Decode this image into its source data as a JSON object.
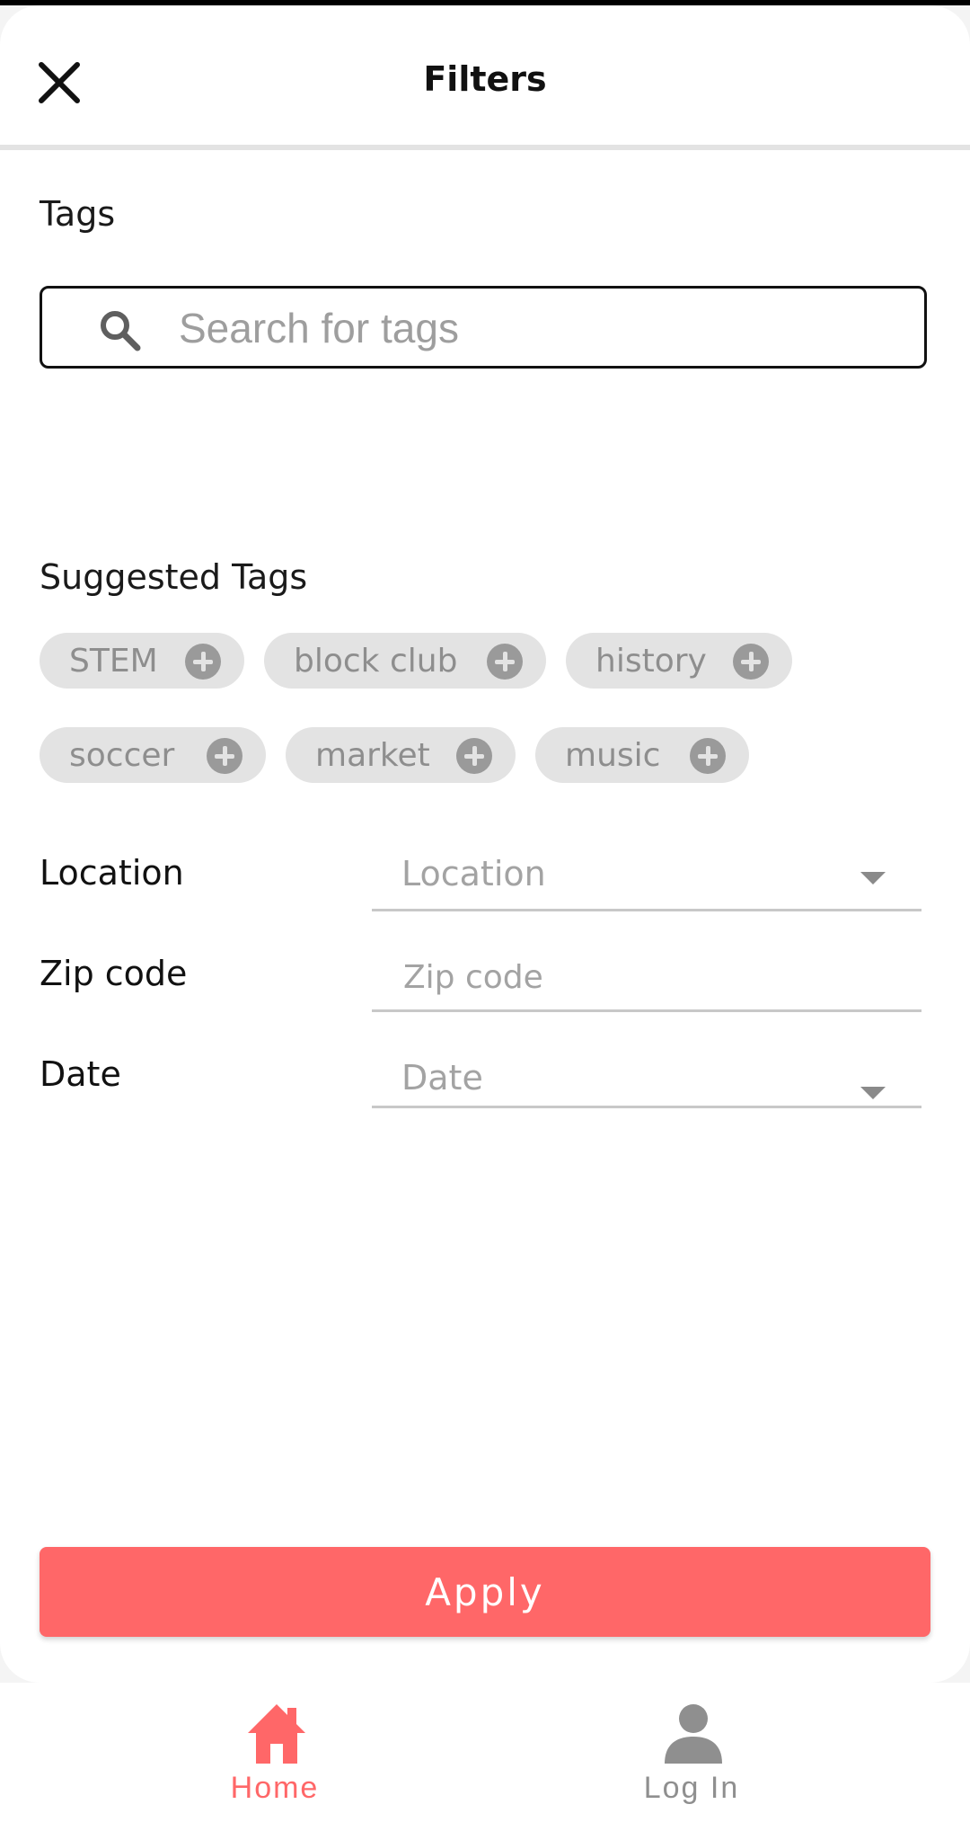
{
  "header": {
    "title": "Filters",
    "close_icon": "close-icon"
  },
  "tags": {
    "label": "Tags",
    "search_placeholder": "Search for tags",
    "search_value": ""
  },
  "suggested": {
    "label": "Suggested Tags",
    "items": [
      {
        "label": "STEM"
      },
      {
        "label": "block club"
      },
      {
        "label": "history"
      },
      {
        "label": "soccer"
      },
      {
        "label": "market"
      },
      {
        "label": "music"
      }
    ]
  },
  "fields": {
    "location": {
      "label": "Location",
      "placeholder": "Location"
    },
    "zip": {
      "label": "Zip code",
      "placeholder": "Zip code"
    },
    "date": {
      "label": "Date",
      "placeholder": "Date"
    }
  },
  "apply_label": "Apply",
  "nav": {
    "home": {
      "label": "Home",
      "icon": "home-icon"
    },
    "login": {
      "label": "Log In",
      "icon": "person-icon"
    }
  },
  "colors": {
    "accent": "#ff6768",
    "chip_bg": "#e3e3e3",
    "chip_text": "#8e8e8e",
    "inactive": "#8f8f8f"
  }
}
